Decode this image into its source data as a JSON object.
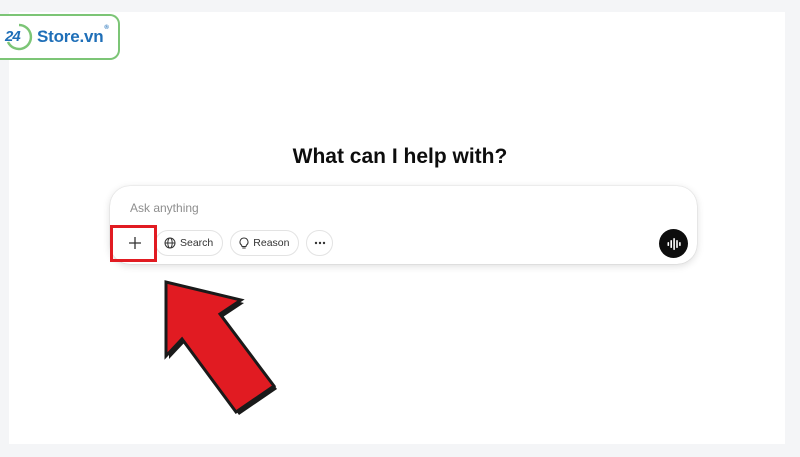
{
  "logo": {
    "number": "24",
    "text": "Store.vn",
    "registered": "®"
  },
  "heading": "What can I help with?",
  "composer": {
    "placeholder": "Ask anything",
    "attach_symbol": "+",
    "search_label": "Search",
    "reason_label": "Reason",
    "more_symbol": "···"
  },
  "icons": {
    "attach": "plus-icon",
    "search": "globe-icon",
    "reason": "lightbulb-icon",
    "more": "ellipsis-icon",
    "voice": "waveform-icon"
  },
  "colors": {
    "logo_blue": "#1f6fb8",
    "logo_border": "#7cc576",
    "highlight_red": "#e11b22",
    "voice_button": "#0d0d0d"
  }
}
